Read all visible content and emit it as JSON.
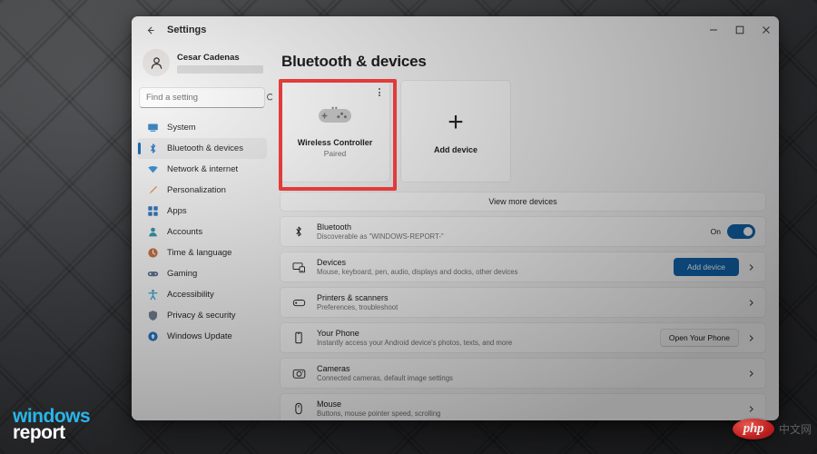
{
  "window": {
    "titlebar_title": "Settings",
    "back_icon": "back-arrow-icon",
    "minimize_label": "–",
    "maximize_label": "□",
    "close_label": "✕"
  },
  "sidebar": {
    "profile": {
      "name": "Cesar Cadenas",
      "email_redacted": true
    },
    "search": {
      "placeholder": "Find a setting",
      "value": "",
      "icon": "search-icon"
    },
    "items": [
      {
        "label": "System",
        "icon": "system-icon",
        "selected": false,
        "color": "#2f7fc0"
      },
      {
        "label": "Bluetooth & devices",
        "icon": "bluetooth-icon",
        "selected": true,
        "color": "#1a6fc4"
      },
      {
        "label": "Network & internet",
        "icon": "wifi-icon",
        "selected": false,
        "color": "#2f8fd0"
      },
      {
        "label": "Personalization",
        "icon": "brush-icon",
        "selected": false,
        "color": "#d08a3a"
      },
      {
        "label": "Apps",
        "icon": "apps-icon",
        "selected": false,
        "color": "#2a6fb8"
      },
      {
        "label": "Accounts",
        "icon": "account-icon",
        "selected": false,
        "color": "#2f8fa8"
      },
      {
        "label": "Time & language",
        "icon": "clock-icon",
        "selected": false,
        "color": "#c06a3a"
      },
      {
        "label": "Gaming",
        "icon": "gamepad-icon",
        "selected": false,
        "color": "#5a6a8a"
      },
      {
        "label": "Accessibility",
        "icon": "accessibility-icon",
        "selected": false,
        "color": "#2f9fd0"
      },
      {
        "label": "Privacy & security",
        "icon": "shield-icon",
        "selected": false,
        "color": "#6a7a8a"
      },
      {
        "label": "Windows Update",
        "icon": "update-icon",
        "selected": false,
        "color": "#1a6fc4"
      }
    ]
  },
  "main": {
    "page_title": "Bluetooth & devices",
    "device_cards": [
      {
        "name": "Wireless Controller",
        "status": "Paired",
        "icon": "gamepad-icon",
        "menu_icon": "kebab-menu-icon",
        "highlighted": true
      }
    ],
    "add_device_card": {
      "label": "Add device",
      "icon": "plus-icon"
    },
    "view_more": {
      "label": "View more devices"
    },
    "rows": [
      {
        "title": "Bluetooth",
        "subtitle": "Discoverable as \"WINDOWS-REPORT-\"",
        "icon": "bluetooth-icon",
        "control": "toggle",
        "toggle_label": "On",
        "toggle_on": true,
        "chevron": false
      },
      {
        "title": "Devices",
        "subtitle": "Mouse, keyboard, pen, audio, displays and docks, other devices",
        "icon": "devices-icon",
        "control": "primary-button",
        "button_label": "Add device",
        "chevron": true
      },
      {
        "title": "Printers & scanners",
        "subtitle": "Preferences, troubleshoot",
        "icon": "printer-icon",
        "control": "none",
        "chevron": true
      },
      {
        "title": "Your Phone",
        "subtitle": "Instantly access your Android device's photos, texts, and more",
        "icon": "phone-icon",
        "control": "secondary-button",
        "button_label": "Open Your Phone",
        "chevron": true
      },
      {
        "title": "Cameras",
        "subtitle": "Connected cameras, default image settings",
        "icon": "camera-icon",
        "control": "none",
        "chevron": true
      },
      {
        "title": "Mouse",
        "subtitle": "Buttons, mouse pointer speed, scrolling",
        "icon": "mouse-icon",
        "control": "none",
        "chevron": true
      }
    ]
  },
  "watermarks": {
    "windows_report": {
      "line1": "windows",
      "line2": "report",
      "color1": "#29b6e8",
      "color2": "#ffffff"
    },
    "php": {
      "text": "php",
      "suffix": "中文网",
      "color": "#c02020"
    }
  },
  "annotation": {
    "color": "#e13b3b",
    "target": "wireless-controller-card"
  }
}
